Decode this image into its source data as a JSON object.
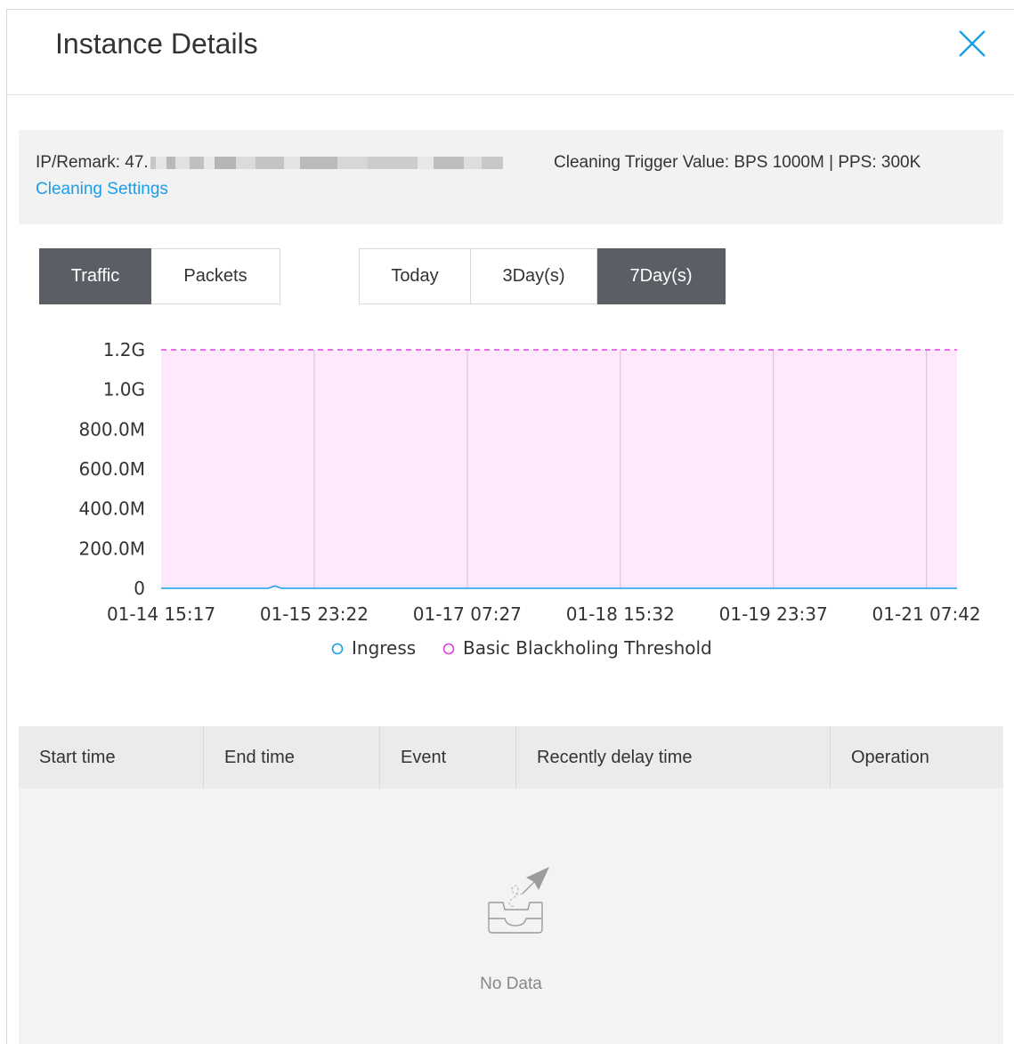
{
  "dialog": {
    "title": "Instance Details"
  },
  "info": {
    "ip_label": "IP/Remark: 47.",
    "trigger": "Cleaning Trigger Value: BPS 1000M | PPS: 300K",
    "settings_link": "Cleaning Settings"
  },
  "type_toggle": [
    {
      "label": "Traffic",
      "active": true
    },
    {
      "label": "Packets",
      "active": false
    }
  ],
  "range_toggle": [
    {
      "label": "Today",
      "active": false
    },
    {
      "label": "3Day(s)",
      "active": false
    },
    {
      "label": "7Day(s)",
      "active": true
    }
  ],
  "chart_data": {
    "type": "line",
    "x": [
      "01-14 15:17",
      "01-15 23:22",
      "01-17 07:27",
      "01-18 15:32",
      "01-19 23:37",
      "01-21 07:42"
    ],
    "y_ticks": [
      "0",
      "200.0M",
      "400.0M",
      "600.0M",
      "800.0M",
      "1.0G",
      "1.2G"
    ],
    "ylim": [
      0,
      1200000000
    ],
    "series": [
      {
        "name": "Ingress",
        "color": "#1a9ee8",
        "values": [
          0,
          0,
          0,
          0,
          0,
          0,
          0,
          0,
          0,
          0,
          0,
          0,
          0,
          0,
          0,
          0,
          0,
          12000000,
          0,
          0,
          0,
          0,
          0,
          0,
          0,
          0,
          0,
          0,
          0,
          0,
          0,
          0,
          0,
          0,
          0,
          0,
          0,
          0,
          0,
          0,
          0,
          0,
          0,
          0,
          0,
          0,
          0,
          0,
          0,
          0,
          0,
          0,
          0,
          0,
          0,
          0,
          0,
          0,
          0,
          0,
          0,
          0,
          0,
          0,
          0,
          0,
          0,
          0,
          0,
          0,
          0,
          0,
          0,
          0,
          0,
          0,
          0,
          0,
          0,
          0,
          0,
          0,
          0,
          0,
          0,
          0,
          0,
          0,
          0,
          0,
          0,
          0,
          0,
          0,
          0,
          0,
          0,
          0,
          0,
          0,
          0,
          0,
          0,
          0,
          0,
          0,
          0,
          0,
          0,
          0,
          0,
          0,
          0,
          0,
          0,
          0,
          0,
          0,
          0,
          0
        ]
      },
      {
        "name": "Basic Blackholing Threshold",
        "color": "#e040e0",
        "values": [
          1200000000,
          1200000000
        ]
      }
    ],
    "legend": "bottom",
    "grid": false
  },
  "table": {
    "columns": [
      "Start time",
      "End time",
      "Event",
      "Recently delay time",
      "Operation"
    ],
    "empty_text": "No Data"
  },
  "icons": {
    "close": "close-icon",
    "empty": "empty-box-icon"
  },
  "colors": {
    "accent": "#1a9ee8",
    "active_button": "#5c5e66",
    "threshold": "#e040e0",
    "threshold_fill": "#fde9fb"
  }
}
